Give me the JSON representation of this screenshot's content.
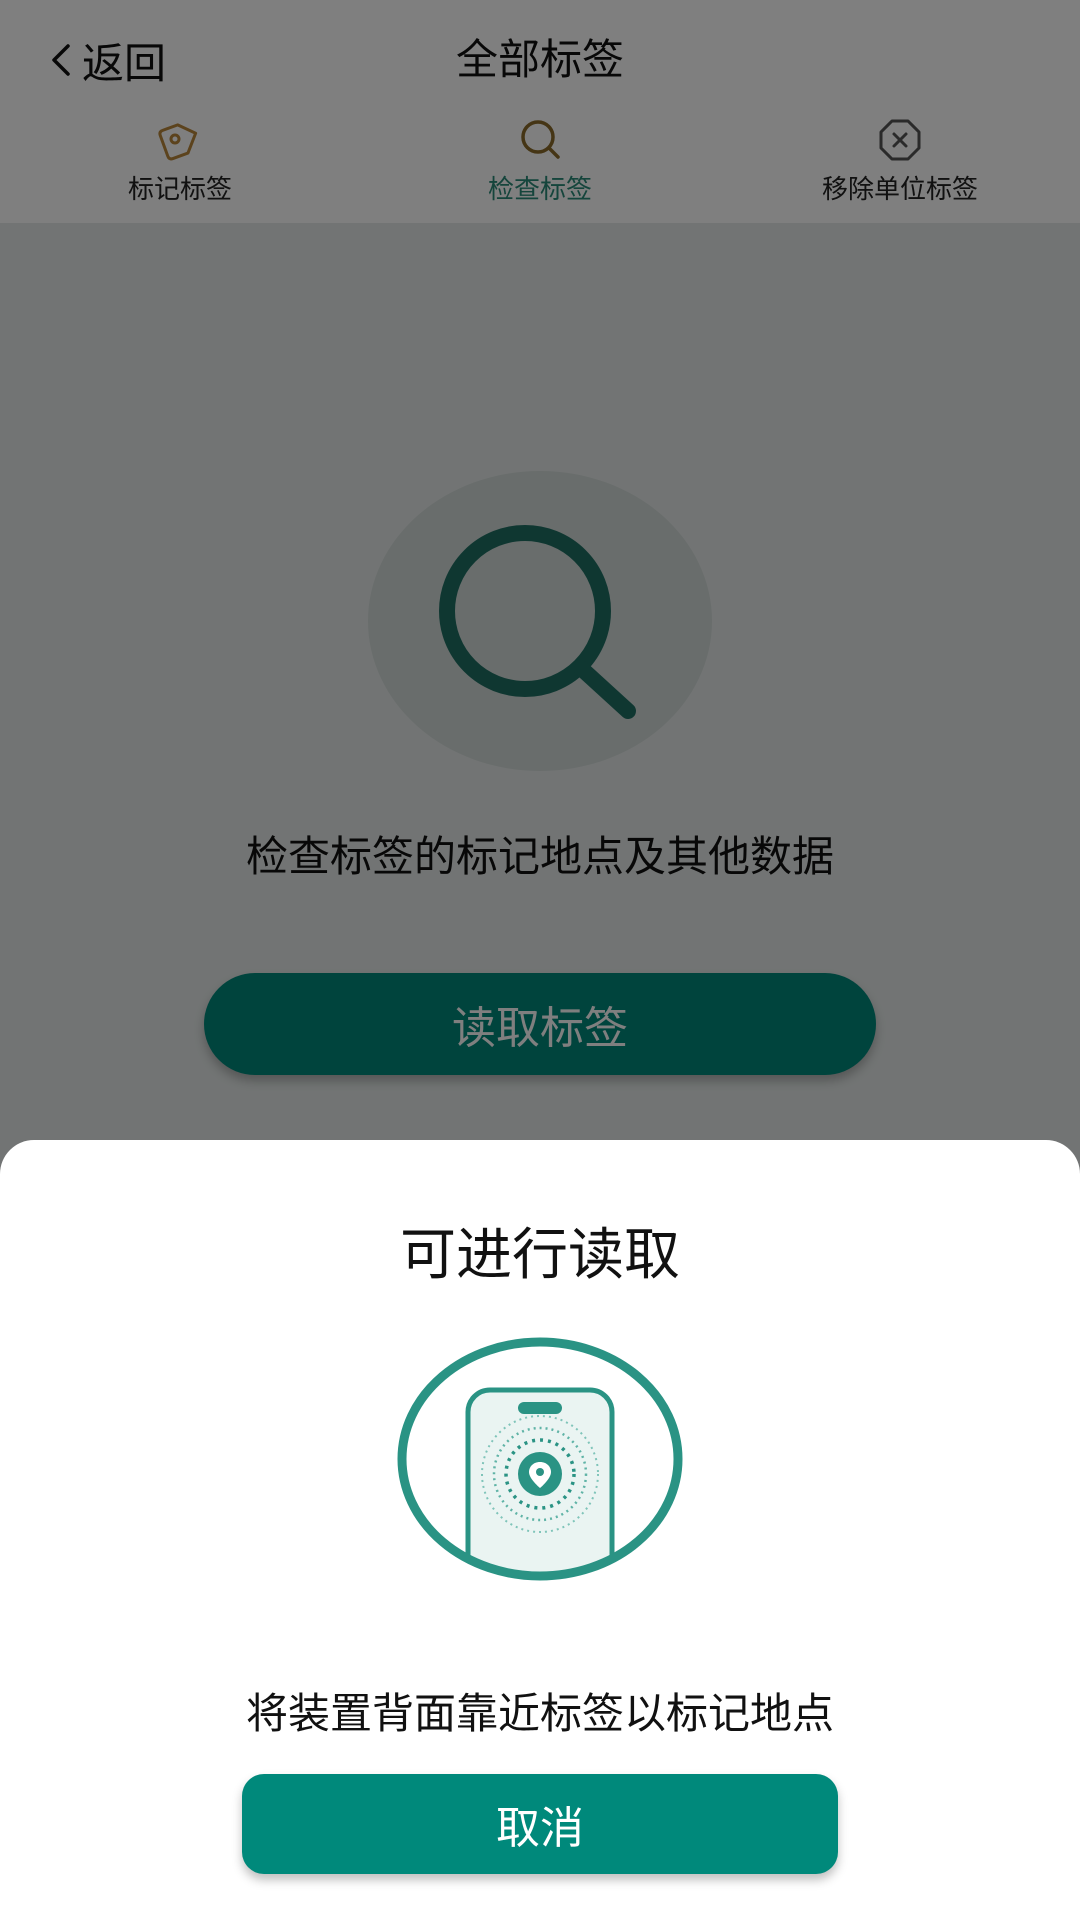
{
  "header": {
    "back_label": "返回",
    "title": "全部标签"
  },
  "tabs": [
    {
      "label": "标记标签",
      "icon": "tag-icon"
    },
    {
      "label": "检查标签",
      "icon": "search-icon",
      "active": true
    },
    {
      "label": "移除单位标签",
      "icon": "remove-icon"
    }
  ],
  "main": {
    "icon": "search-icon",
    "description": "检查标签的标记地点及其他数据",
    "read_button_label": "读取标签"
  },
  "sheet": {
    "title": "可进行读取",
    "illustration": "phone-nfc-icon",
    "instruction": "将装置背面靠近标签以标记地点",
    "cancel_label": "取消"
  },
  "colors": {
    "accent": "#00897b",
    "accent_dark": "#1f6e63",
    "tag_icon": "#b8863b",
    "search_tab_icon": "#8a6a2a",
    "remove_icon": "#555555",
    "background": "#e4e9e8"
  }
}
